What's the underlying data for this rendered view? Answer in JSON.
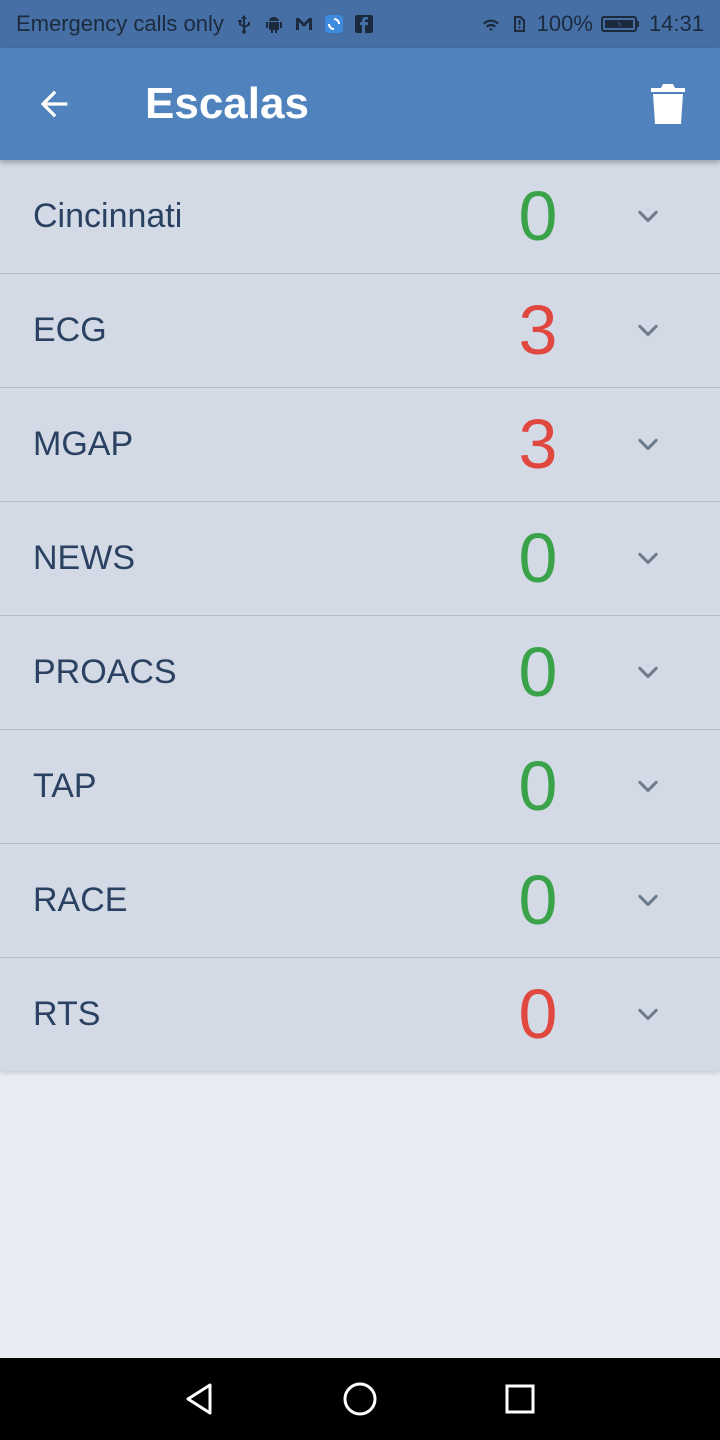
{
  "status_bar": {
    "carrier_text": "Emergency calls only",
    "left_icons": [
      "usb-icon",
      "android-icon",
      "gmail-icon",
      "sync-app-icon",
      "facebook-icon"
    ],
    "right_icons": [
      "wifi-icon",
      "sim-alert-icon"
    ],
    "battery_text": "100%",
    "time": "14:31"
  },
  "app_bar": {
    "title": "Escalas",
    "back_icon": "arrow-left-icon",
    "action_icon": "trash-icon",
    "color": "#5082bd"
  },
  "scales": [
    {
      "name": "Cincinnati",
      "score": "0",
      "status": "green"
    },
    {
      "name": "ECG",
      "score": "3",
      "status": "red"
    },
    {
      "name": "MGAP",
      "score": "3",
      "status": "red"
    },
    {
      "name": "NEWS",
      "score": "0",
      "status": "green"
    },
    {
      "name": "PROACS",
      "score": "0",
      "status": "green"
    },
    {
      "name": "TAP",
      "score": "0",
      "status": "green"
    },
    {
      "name": "RACE",
      "score": "0",
      "status": "green"
    },
    {
      "name": "RTS",
      "score": "0",
      "status": "red"
    }
  ],
  "colors": {
    "green": "#3aa34a",
    "red": "#e0473e",
    "row_background": "#d3dae6",
    "page_background": "#e9edf3"
  },
  "nav_bar": {
    "buttons": [
      "back-triangle-icon",
      "home-circle-icon",
      "recents-square-icon"
    ]
  }
}
